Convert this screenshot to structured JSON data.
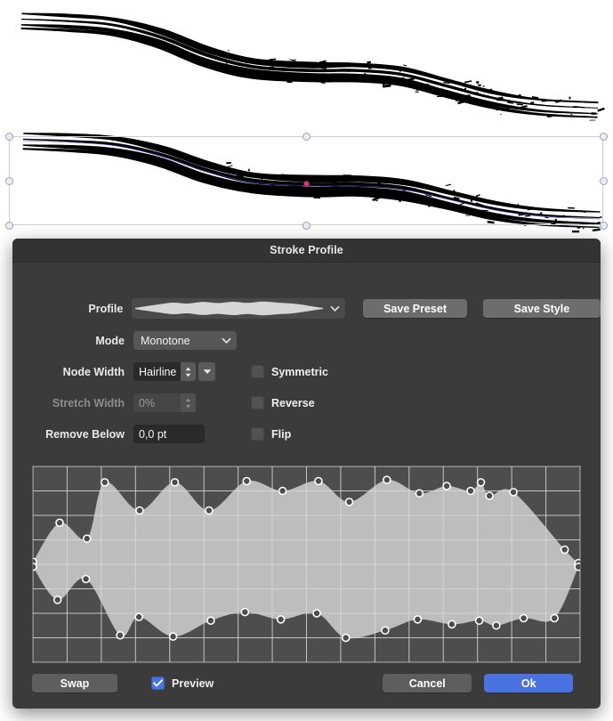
{
  "window": {
    "title": "Stroke Profile"
  },
  "canvas": {
    "strokes": [
      {
        "name": "stroke-preview-top"
      },
      {
        "name": "stroke-selected"
      }
    ],
    "selection": {
      "handles": 8,
      "handle_color": "#e9edf3",
      "center_node_color": "#d6397a"
    }
  },
  "form": {
    "profile": {
      "label": "Profile",
      "preview_name": "tapered-brush-profile"
    },
    "save_preset_label": "Save Preset",
    "save_style_label": "Save Style",
    "mode": {
      "label": "Mode",
      "value": "Monotone"
    },
    "node_width": {
      "label": "Node Width",
      "value": "Hairline"
    },
    "stretch_width": {
      "label": "Stretch Width",
      "value": "0%",
      "disabled": true
    },
    "remove_below": {
      "label": "Remove Below",
      "value": "0,0 pt"
    },
    "checkboxes": [
      {
        "label": "Symmetric",
        "checked": false
      },
      {
        "label": "Reverse",
        "checked": false
      },
      {
        "label": "Flip",
        "checked": false
      }
    ]
  },
  "footer": {
    "swap_label": "Swap",
    "preview_label": "Preview",
    "preview_checked": true,
    "cancel_label": "Cancel",
    "ok_label": "Ok"
  },
  "colors": {
    "dialog_bg": "#3b3b3b",
    "titlebar_bg": "#333333",
    "accent": "#4a72e0",
    "graph_bg": "#4d4d4d",
    "graph_fill": "#bdbdbd",
    "grid_line": "#d9d9d9"
  },
  "chart_data": {
    "type": "area",
    "title": "Stroke width profile editor",
    "xlabel": "",
    "ylabel": "",
    "xlim": [
      0,
      16
    ],
    "ylim": [
      0,
      8
    ],
    "grid": true,
    "grid_cols": 16,
    "grid_rows": 8,
    "legend": "none",
    "series": [
      {
        "name": "upper-envelope",
        "points": [
          [
            0.0,
            4.1
          ],
          [
            0.78,
            5.7
          ],
          [
            1.58,
            5.05
          ],
          [
            2.1,
            7.35
          ],
          [
            3.12,
            6.2
          ],
          [
            4.15,
            7.35
          ],
          [
            5.15,
            6.2
          ],
          [
            6.25,
            7.4
          ],
          [
            7.3,
            7.0
          ],
          [
            8.35,
            7.4
          ],
          [
            9.25,
            6.55
          ],
          [
            10.35,
            7.45
          ],
          [
            11.3,
            6.9
          ],
          [
            12.1,
            7.2
          ],
          [
            12.8,
            7.0
          ],
          [
            13.1,
            7.35
          ],
          [
            13.35,
            6.8
          ],
          [
            14.05,
            6.95
          ],
          [
            15.55,
            4.6
          ],
          [
            15.95,
            4.05
          ]
        ]
      },
      {
        "name": "lower-envelope",
        "points": [
          [
            0.0,
            3.9
          ],
          [
            0.72,
            2.55
          ],
          [
            1.55,
            3.4
          ],
          [
            2.55,
            1.1
          ],
          [
            3.1,
            1.85
          ],
          [
            4.1,
            1.05
          ],
          [
            5.2,
            1.7
          ],
          [
            6.2,
            2.05
          ],
          [
            7.25,
            1.75
          ],
          [
            8.3,
            2.0
          ],
          [
            9.15,
            1.0
          ],
          [
            10.3,
            1.3
          ],
          [
            11.25,
            1.75
          ],
          [
            12.25,
            1.55
          ],
          [
            13.05,
            1.7
          ],
          [
            13.55,
            1.5
          ],
          [
            14.35,
            1.8
          ],
          [
            15.25,
            1.8
          ],
          [
            15.95,
            3.9
          ]
        ]
      }
    ],
    "node_marker": {
      "shape": "circle",
      "fill": "#4d4d4d",
      "stroke": "#ffffff",
      "radius": 4
    }
  }
}
